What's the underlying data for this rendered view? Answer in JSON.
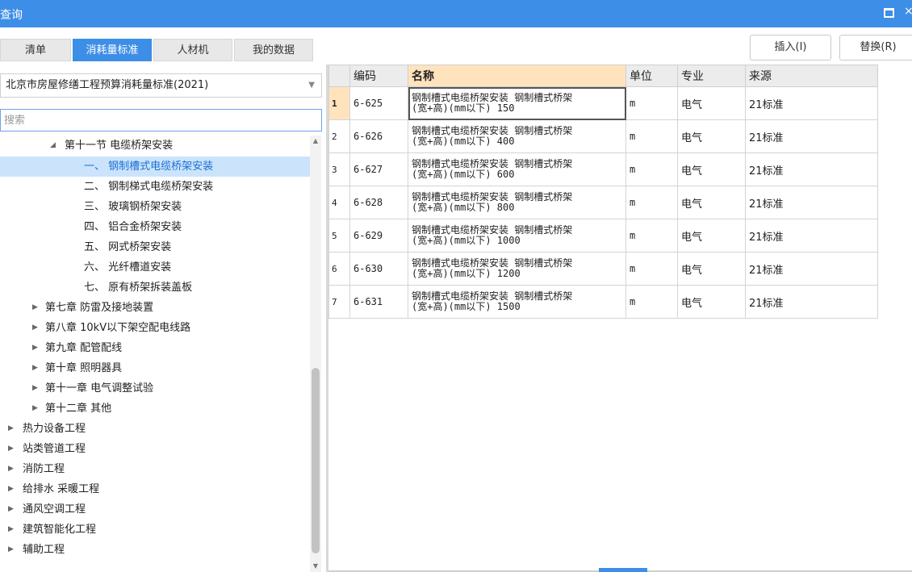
{
  "window": {
    "title": "查询"
  },
  "tabs": [
    {
      "label": "清单"
    },
    {
      "label": "消耗量标准"
    },
    {
      "label": "人材机"
    },
    {
      "label": "我的数据"
    }
  ],
  "toolbar": {
    "insert_label": "插入(I)",
    "replace_label": "替换(R)"
  },
  "standard_select": {
    "value": "北京市房屋修缮工程预算消耗量标准(2021)"
  },
  "search": {
    "placeholder": "搜索"
  },
  "tree": [
    {
      "label": "第十一节 电缆桥架安装",
      "expanded": true
    },
    {
      "label": "一、 钢制槽式电缆桥架安装",
      "selected": true
    },
    {
      "label": "二、 钢制梯式电缆桥架安装"
    },
    {
      "label": "三、 玻璃钢桥架安装"
    },
    {
      "label": "四、 铝合金桥架安装"
    },
    {
      "label": "五、 网式桥架安装"
    },
    {
      "label": "六、 光纤槽道安装"
    },
    {
      "label": "七、 原有桥架拆装盖板"
    },
    {
      "label": "第七章 防雷及接地装置"
    },
    {
      "label": "第八章 10kV以下架空配电线路"
    },
    {
      "label": "第九章 配管配线"
    },
    {
      "label": "第十章 照明器具"
    },
    {
      "label": "第十一章 电气调整试验"
    },
    {
      "label": "第十二章 其他"
    },
    {
      "label": "热力设备工程"
    },
    {
      "label": "站类管道工程"
    },
    {
      "label": "消防工程"
    },
    {
      "label": "给排水 采暖工程"
    },
    {
      "label": "通风空调工程"
    },
    {
      "label": "建筑智能化工程"
    },
    {
      "label": "辅助工程"
    }
  ],
  "table": {
    "headers": {
      "code": "编码",
      "name": "名称",
      "unit": "单位",
      "specialty": "专业",
      "source": "来源"
    },
    "rows": [
      {
        "num": "1",
        "code": "6-625",
        "name_line1": "钢制槽式电缆桥架安装 钢制槽式桥架",
        "name_line2": "(宽+高)(mm以下) 150",
        "unit": "m",
        "specialty": "电气",
        "source": "21标准"
      },
      {
        "num": "2",
        "code": "6-626",
        "name_line1": "钢制槽式电缆桥架安装 钢制槽式桥架",
        "name_line2": "(宽+高)(mm以下) 400",
        "unit": "m",
        "specialty": "电气",
        "source": "21标准"
      },
      {
        "num": "3",
        "code": "6-627",
        "name_line1": "钢制槽式电缆桥架安装 钢制槽式桥架",
        "name_line2": "(宽+高)(mm以下) 600",
        "unit": "m",
        "specialty": "电气",
        "source": "21标准"
      },
      {
        "num": "4",
        "code": "6-628",
        "name_line1": "钢制槽式电缆桥架安装 钢制槽式桥架",
        "name_line2": "(宽+高)(mm以下) 800",
        "unit": "m",
        "specialty": "电气",
        "source": "21标准"
      },
      {
        "num": "5",
        "code": "6-629",
        "name_line1": "钢制槽式电缆桥架安装 钢制槽式桥架",
        "name_line2": "(宽+高)(mm以下) 1000",
        "unit": "m",
        "specialty": "电气",
        "source": "21标准"
      },
      {
        "num": "6",
        "code": "6-630",
        "name_line1": "钢制槽式电缆桥架安装 钢制槽式桥架",
        "name_line2": "(宽+高)(mm以下) 1200",
        "unit": "m",
        "specialty": "电气",
        "source": "21标准"
      },
      {
        "num": "7",
        "code": "6-631",
        "name_line1": "钢制槽式电缆桥架安装 钢制槽式桥架",
        "name_line2": "(宽+高)(mm以下) 1500",
        "unit": "m",
        "specialty": "电气",
        "source": "21标准"
      }
    ]
  },
  "colors": {
    "accent": "#3d8ee6",
    "selected_row": "#cce4fb",
    "header_highlight": "#ffe3bd"
  }
}
